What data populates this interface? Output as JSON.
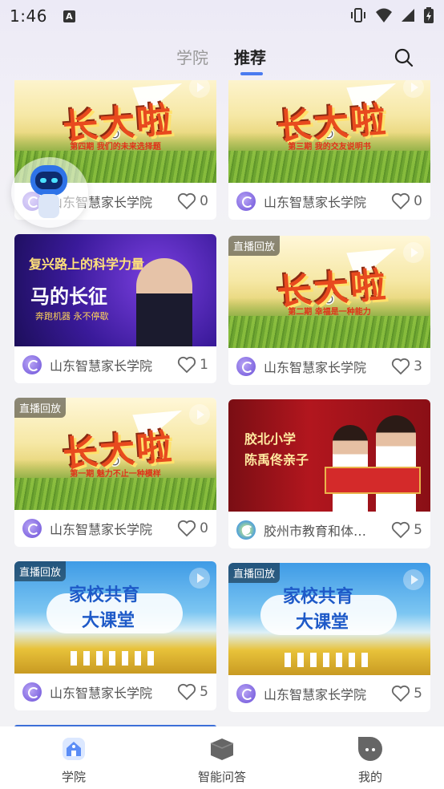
{
  "status_bar": {
    "time": "1:46",
    "notif_letter": "A"
  },
  "top_tabs": {
    "tab1": "学院",
    "tab2": "推荐"
  },
  "cards": [
    {
      "badge": "",
      "org": "山东智慧家长学院",
      "likes": "0",
      "art_title": "长大啦",
      "art_sub": "第四期  我们的未来选择题"
    },
    {
      "badge": "",
      "org": "山东智慧家长学院",
      "likes": "0",
      "art_title": "长大啦",
      "art_sub": "第三期  我的交友说明书"
    },
    {
      "badge": "",
      "org": "山东智慧家长学院",
      "likes": "1",
      "art_t1": "复兴路上的科学力量",
      "art_t2": "马的长征",
      "art_t3": "奔跑机器  永不停歇"
    },
    {
      "badge": "直播回放",
      "org": "山东智慧家长学院",
      "likes": "3",
      "art_title": "长大啦",
      "art_sub": "第二期  幸福是一种能力"
    },
    {
      "badge": "直播回放",
      "org": "山东智慧家长学院",
      "likes": "0",
      "art_title": "长大啦",
      "art_sub": "第一期  魅力不止一种模样"
    },
    {
      "badge": "",
      "org": "胶州市教育和体…",
      "likes": "5",
      "art_t1": "胶北小学",
      "art_t2": "陈禹佟亲子"
    },
    {
      "badge": "直播回放",
      "org": "山东智慧家长学院",
      "likes": "5",
      "art_t1": "家校共育",
      "art_t2": "大课堂"
    },
    {
      "badge": "直播回放",
      "org": "山东智慧家长学院",
      "likes": "5",
      "art_t1": "家校共育",
      "art_t2": "大课堂"
    }
  ],
  "bottom_nav": [
    {
      "label": "学院",
      "icon": "school-icon",
      "active": true
    },
    {
      "label": "智能问答",
      "icon": "graduation-cap-icon",
      "active": false
    },
    {
      "label": "我的",
      "icon": "profile-face-icon",
      "active": false
    }
  ],
  "colors": {
    "accent": "#4A7BF0",
    "badge_bg": "#00000073",
    "card_bg": "#FFFFFF"
  }
}
